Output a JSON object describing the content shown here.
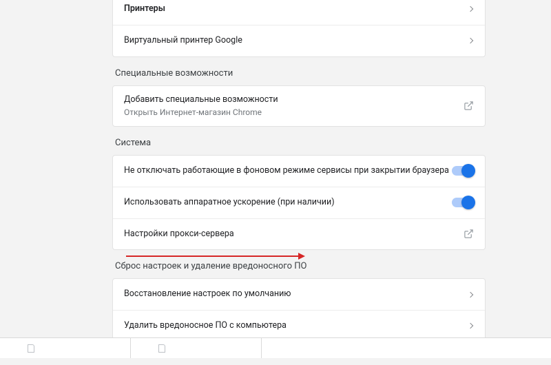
{
  "printing": {
    "items": [
      {
        "label": "Принтеры"
      },
      {
        "label": "Виртуальный принтер Google"
      }
    ]
  },
  "accessibility": {
    "title": "Специальные возможности",
    "item": {
      "label": "Добавить специальные возможности",
      "sub": "Открыть Интернет-магазин Chrome"
    }
  },
  "system": {
    "title": "Система",
    "items": [
      {
        "label": "Не отключать работающие в фоновом режиме сервисы при закрытии браузера",
        "toggle": true
      },
      {
        "label": "Использовать аппаратное ускорение (при наличии)",
        "toggle": true
      },
      {
        "label": "Настройки прокси-сервера",
        "external": true
      }
    ]
  },
  "reset": {
    "title": "Сброс настроек и удаление вредоносного ПО",
    "items": [
      {
        "label": "Восстановление настроек по умолчанию"
      },
      {
        "label": "Удалить вредоносное ПО с компьютера"
      }
    ]
  }
}
